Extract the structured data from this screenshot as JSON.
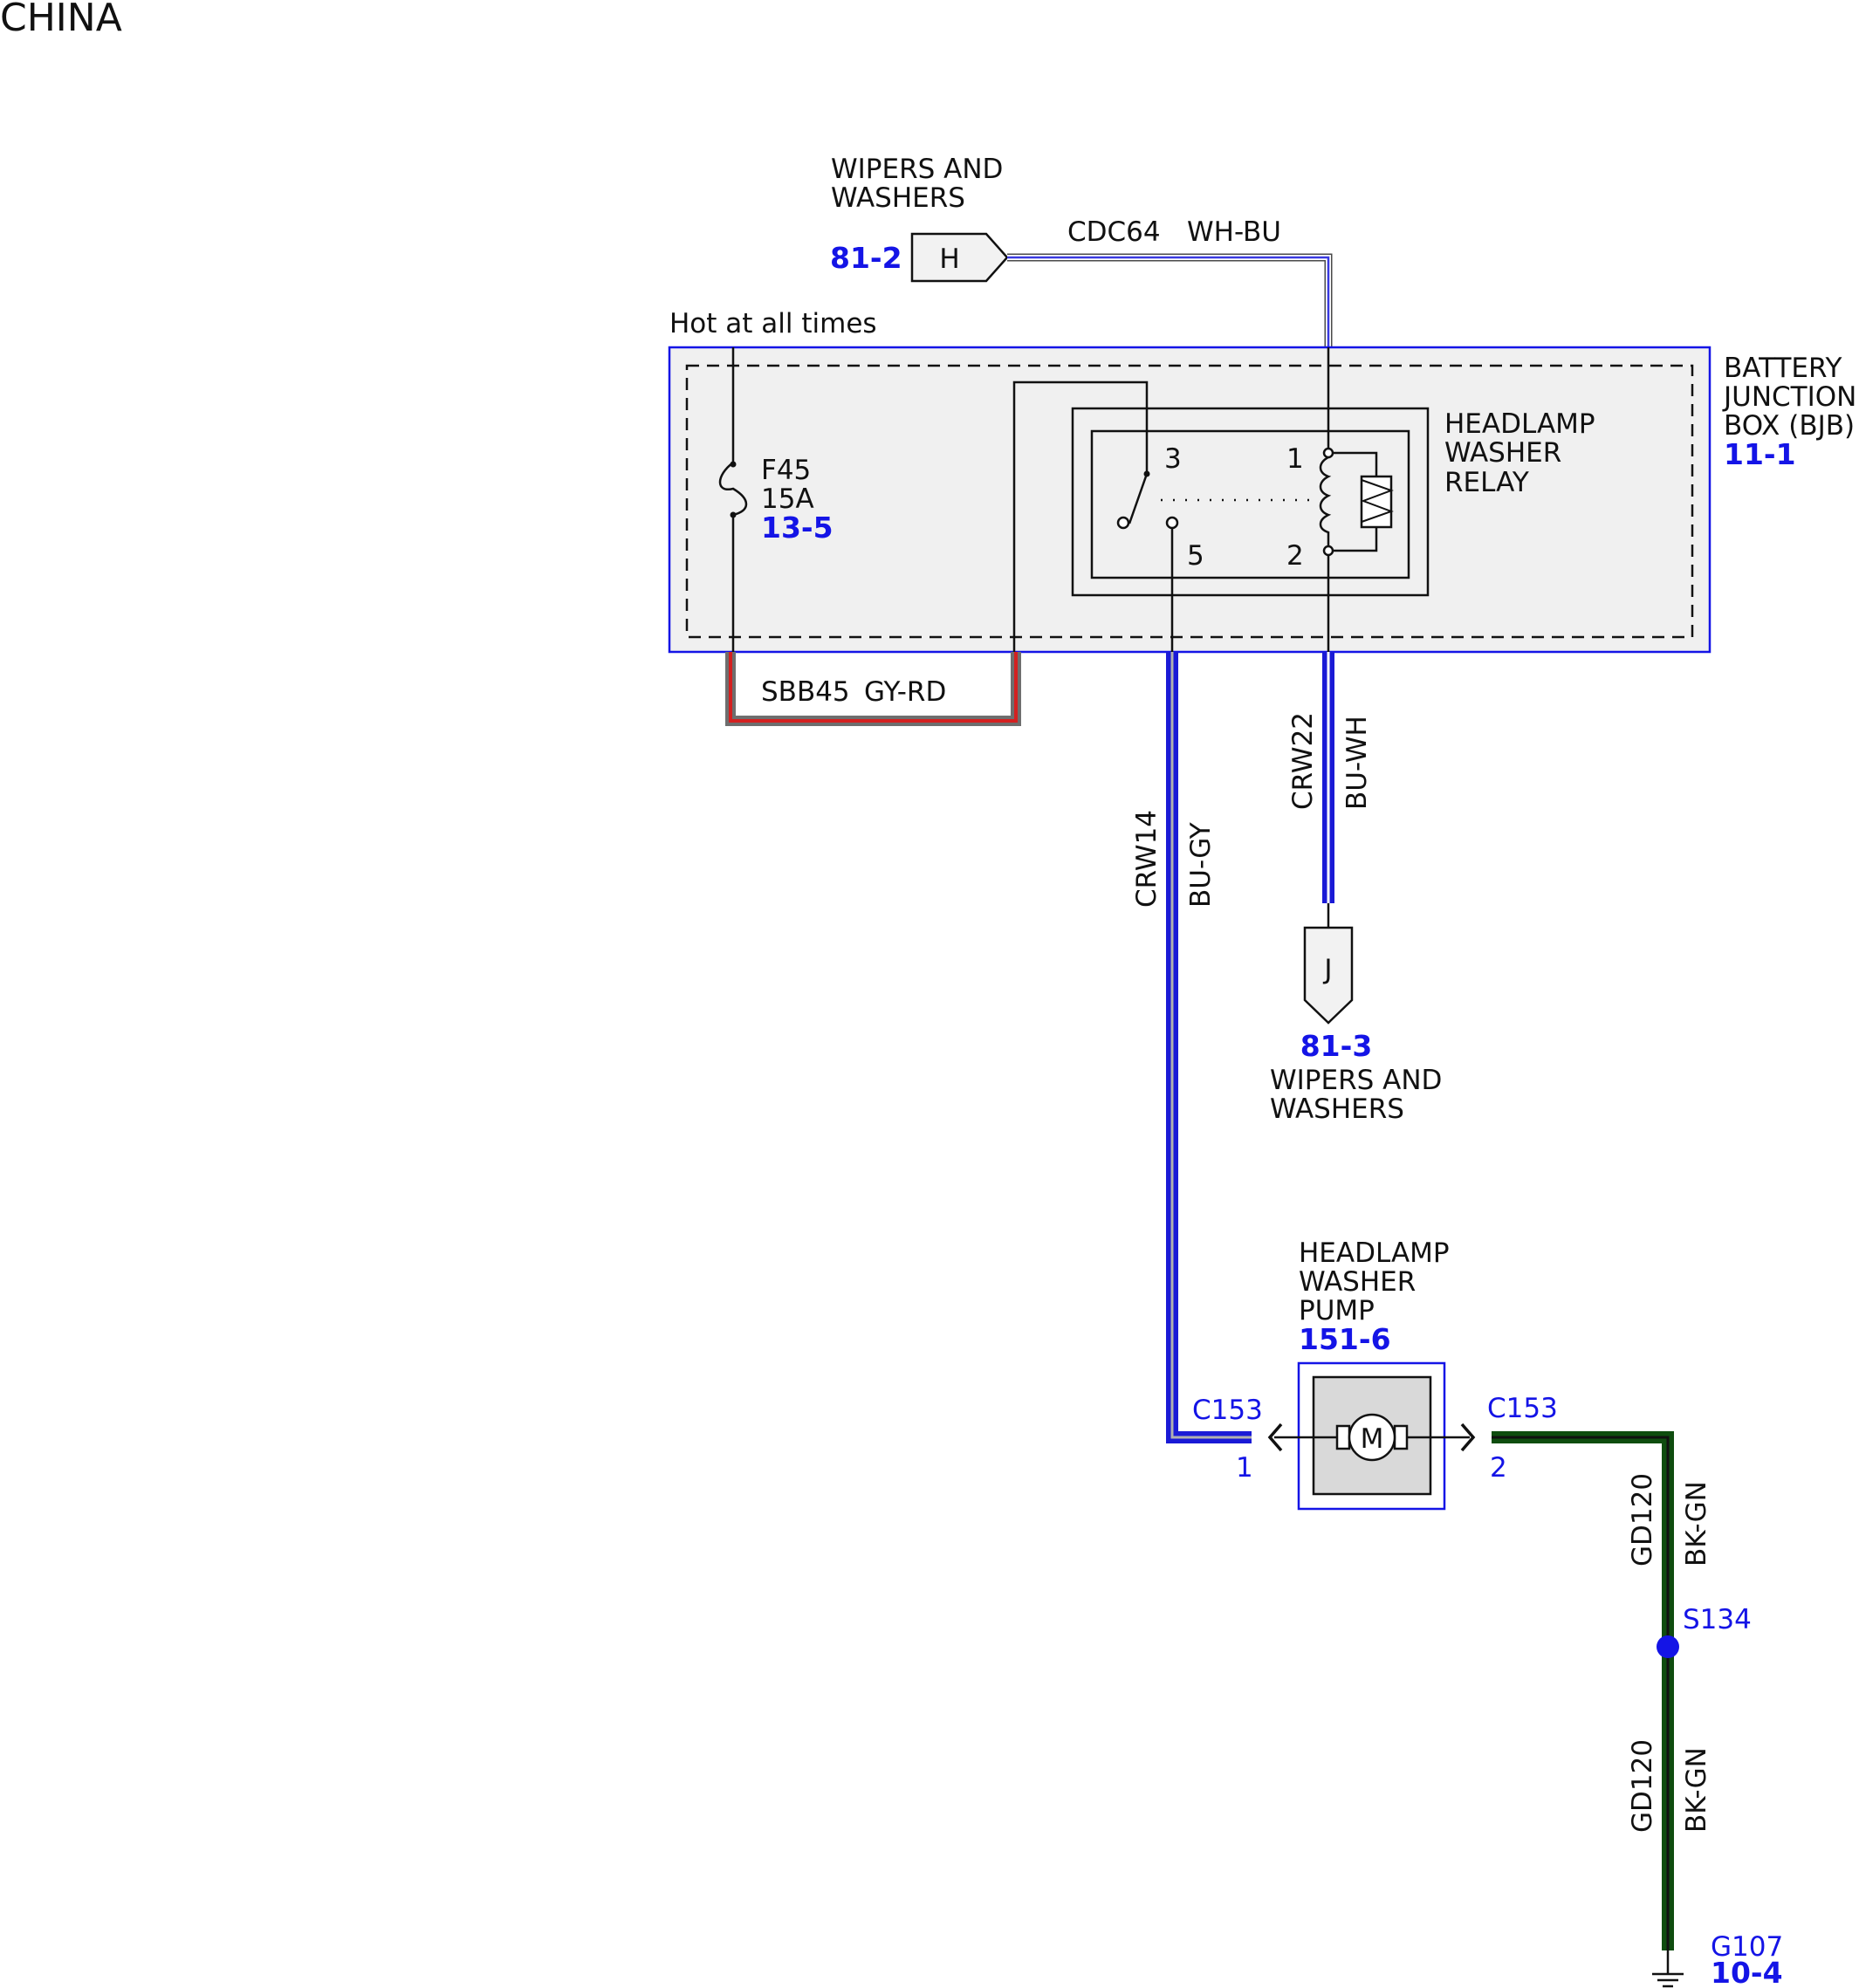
{
  "page_title": "CHINA",
  "module_top": {
    "name_line1": "WIPERS AND",
    "name_line2": "WASHERS",
    "ref": "81-2",
    "pin": "H"
  },
  "wire_cdc64": {
    "circuit": "CDC64",
    "color": "WH-BU"
  },
  "hot_label": "Hot at all times",
  "bjb": {
    "line1": "BATTERY",
    "line2": "JUNCTION",
    "line3": "BOX (BJB)",
    "ref": "11-1"
  },
  "fuse": {
    "id": "F45",
    "rating": "15A",
    "ref": "13-5"
  },
  "relay": {
    "line1": "HEADLAMP",
    "line2": "WASHER",
    "line3": "RELAY",
    "pins": {
      "p1": "1",
      "p2": "2",
      "p3": "3",
      "p5": "5"
    }
  },
  "wire_sbb45": {
    "circuit": "SBB45",
    "color": "GY-RD"
  },
  "wire_crw14": {
    "circuit": "CRW14",
    "color": "BU-GY"
  },
  "wire_crw22": {
    "circuit": "CRW22",
    "color": "BU-WH"
  },
  "module_j": {
    "pin": "J",
    "ref": "81-3",
    "name_line1": "WIPERS AND",
    "name_line2": "WASHERS"
  },
  "pump": {
    "line1": "HEADLAMP",
    "line2": "WASHER",
    "line3": "PUMP",
    "ref": "151-6",
    "motor_symbol": "M"
  },
  "connector_left": {
    "id": "C153",
    "pin": "1"
  },
  "connector_right": {
    "id": "C153",
    "pin": "2"
  },
  "wire_gd120_upper": {
    "circuit": "GD120",
    "color": "BK-GN"
  },
  "wire_gd120_lower": {
    "circuit": "GD120",
    "color": "BK-GN"
  },
  "splice": {
    "id": "S134"
  },
  "ground": {
    "id": "G107",
    "ref": "10-4"
  },
  "colors": {
    "ref_blue": "#1414e6",
    "wire_blue": "#1a1ad6",
    "wire_green": "#0f4d0f",
    "wire_red": "#d42020",
    "wire_gray": "#6e6e6e",
    "box_fill": "#f0f0f0"
  }
}
